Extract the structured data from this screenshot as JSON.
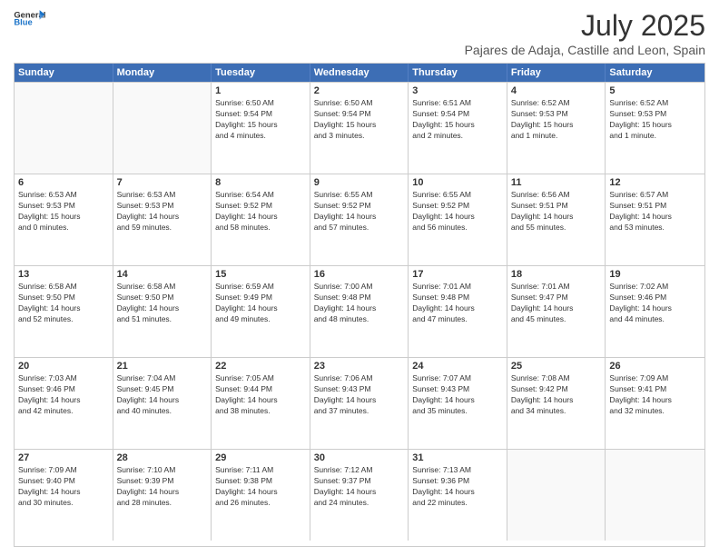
{
  "header": {
    "logo_line1": "General",
    "logo_line2": "Blue",
    "month": "July 2025",
    "location": "Pajares de Adaja, Castille and Leon, Spain"
  },
  "weekdays": [
    "Sunday",
    "Monday",
    "Tuesday",
    "Wednesday",
    "Thursday",
    "Friday",
    "Saturday"
  ],
  "weeks": [
    [
      {
        "day": "",
        "empty": true,
        "info": ""
      },
      {
        "day": "",
        "empty": true,
        "info": ""
      },
      {
        "day": "1",
        "info": "Sunrise: 6:50 AM\nSunset: 9:54 PM\nDaylight: 15 hours\nand 4 minutes."
      },
      {
        "day": "2",
        "info": "Sunrise: 6:50 AM\nSunset: 9:54 PM\nDaylight: 15 hours\nand 3 minutes."
      },
      {
        "day": "3",
        "info": "Sunrise: 6:51 AM\nSunset: 9:54 PM\nDaylight: 15 hours\nand 2 minutes."
      },
      {
        "day": "4",
        "info": "Sunrise: 6:52 AM\nSunset: 9:53 PM\nDaylight: 15 hours\nand 1 minute."
      },
      {
        "day": "5",
        "info": "Sunrise: 6:52 AM\nSunset: 9:53 PM\nDaylight: 15 hours\nand 1 minute."
      }
    ],
    [
      {
        "day": "6",
        "info": "Sunrise: 6:53 AM\nSunset: 9:53 PM\nDaylight: 15 hours\nand 0 minutes."
      },
      {
        "day": "7",
        "info": "Sunrise: 6:53 AM\nSunset: 9:53 PM\nDaylight: 14 hours\nand 59 minutes."
      },
      {
        "day": "8",
        "info": "Sunrise: 6:54 AM\nSunset: 9:52 PM\nDaylight: 14 hours\nand 58 minutes."
      },
      {
        "day": "9",
        "info": "Sunrise: 6:55 AM\nSunset: 9:52 PM\nDaylight: 14 hours\nand 57 minutes."
      },
      {
        "day": "10",
        "info": "Sunrise: 6:55 AM\nSunset: 9:52 PM\nDaylight: 14 hours\nand 56 minutes."
      },
      {
        "day": "11",
        "info": "Sunrise: 6:56 AM\nSunset: 9:51 PM\nDaylight: 14 hours\nand 55 minutes."
      },
      {
        "day": "12",
        "info": "Sunrise: 6:57 AM\nSunset: 9:51 PM\nDaylight: 14 hours\nand 53 minutes."
      }
    ],
    [
      {
        "day": "13",
        "info": "Sunrise: 6:58 AM\nSunset: 9:50 PM\nDaylight: 14 hours\nand 52 minutes."
      },
      {
        "day": "14",
        "info": "Sunrise: 6:58 AM\nSunset: 9:50 PM\nDaylight: 14 hours\nand 51 minutes."
      },
      {
        "day": "15",
        "info": "Sunrise: 6:59 AM\nSunset: 9:49 PM\nDaylight: 14 hours\nand 49 minutes."
      },
      {
        "day": "16",
        "info": "Sunrise: 7:00 AM\nSunset: 9:48 PM\nDaylight: 14 hours\nand 48 minutes."
      },
      {
        "day": "17",
        "info": "Sunrise: 7:01 AM\nSunset: 9:48 PM\nDaylight: 14 hours\nand 47 minutes."
      },
      {
        "day": "18",
        "info": "Sunrise: 7:01 AM\nSunset: 9:47 PM\nDaylight: 14 hours\nand 45 minutes."
      },
      {
        "day": "19",
        "info": "Sunrise: 7:02 AM\nSunset: 9:46 PM\nDaylight: 14 hours\nand 44 minutes."
      }
    ],
    [
      {
        "day": "20",
        "info": "Sunrise: 7:03 AM\nSunset: 9:46 PM\nDaylight: 14 hours\nand 42 minutes."
      },
      {
        "day": "21",
        "info": "Sunrise: 7:04 AM\nSunset: 9:45 PM\nDaylight: 14 hours\nand 40 minutes."
      },
      {
        "day": "22",
        "info": "Sunrise: 7:05 AM\nSunset: 9:44 PM\nDaylight: 14 hours\nand 38 minutes."
      },
      {
        "day": "23",
        "info": "Sunrise: 7:06 AM\nSunset: 9:43 PM\nDaylight: 14 hours\nand 37 minutes."
      },
      {
        "day": "24",
        "info": "Sunrise: 7:07 AM\nSunset: 9:43 PM\nDaylight: 14 hours\nand 35 minutes."
      },
      {
        "day": "25",
        "info": "Sunrise: 7:08 AM\nSunset: 9:42 PM\nDaylight: 14 hours\nand 34 minutes."
      },
      {
        "day": "26",
        "info": "Sunrise: 7:09 AM\nSunset: 9:41 PM\nDaylight: 14 hours\nand 32 minutes."
      }
    ],
    [
      {
        "day": "27",
        "info": "Sunrise: 7:09 AM\nSunset: 9:40 PM\nDaylight: 14 hours\nand 30 minutes."
      },
      {
        "day": "28",
        "info": "Sunrise: 7:10 AM\nSunset: 9:39 PM\nDaylight: 14 hours\nand 28 minutes."
      },
      {
        "day": "29",
        "info": "Sunrise: 7:11 AM\nSunset: 9:38 PM\nDaylight: 14 hours\nand 26 minutes."
      },
      {
        "day": "30",
        "info": "Sunrise: 7:12 AM\nSunset: 9:37 PM\nDaylight: 14 hours\nand 24 minutes."
      },
      {
        "day": "31",
        "info": "Sunrise: 7:13 AM\nSunset: 9:36 PM\nDaylight: 14 hours\nand 22 minutes."
      },
      {
        "day": "",
        "empty": true,
        "info": ""
      },
      {
        "day": "",
        "empty": true,
        "info": ""
      }
    ]
  ]
}
